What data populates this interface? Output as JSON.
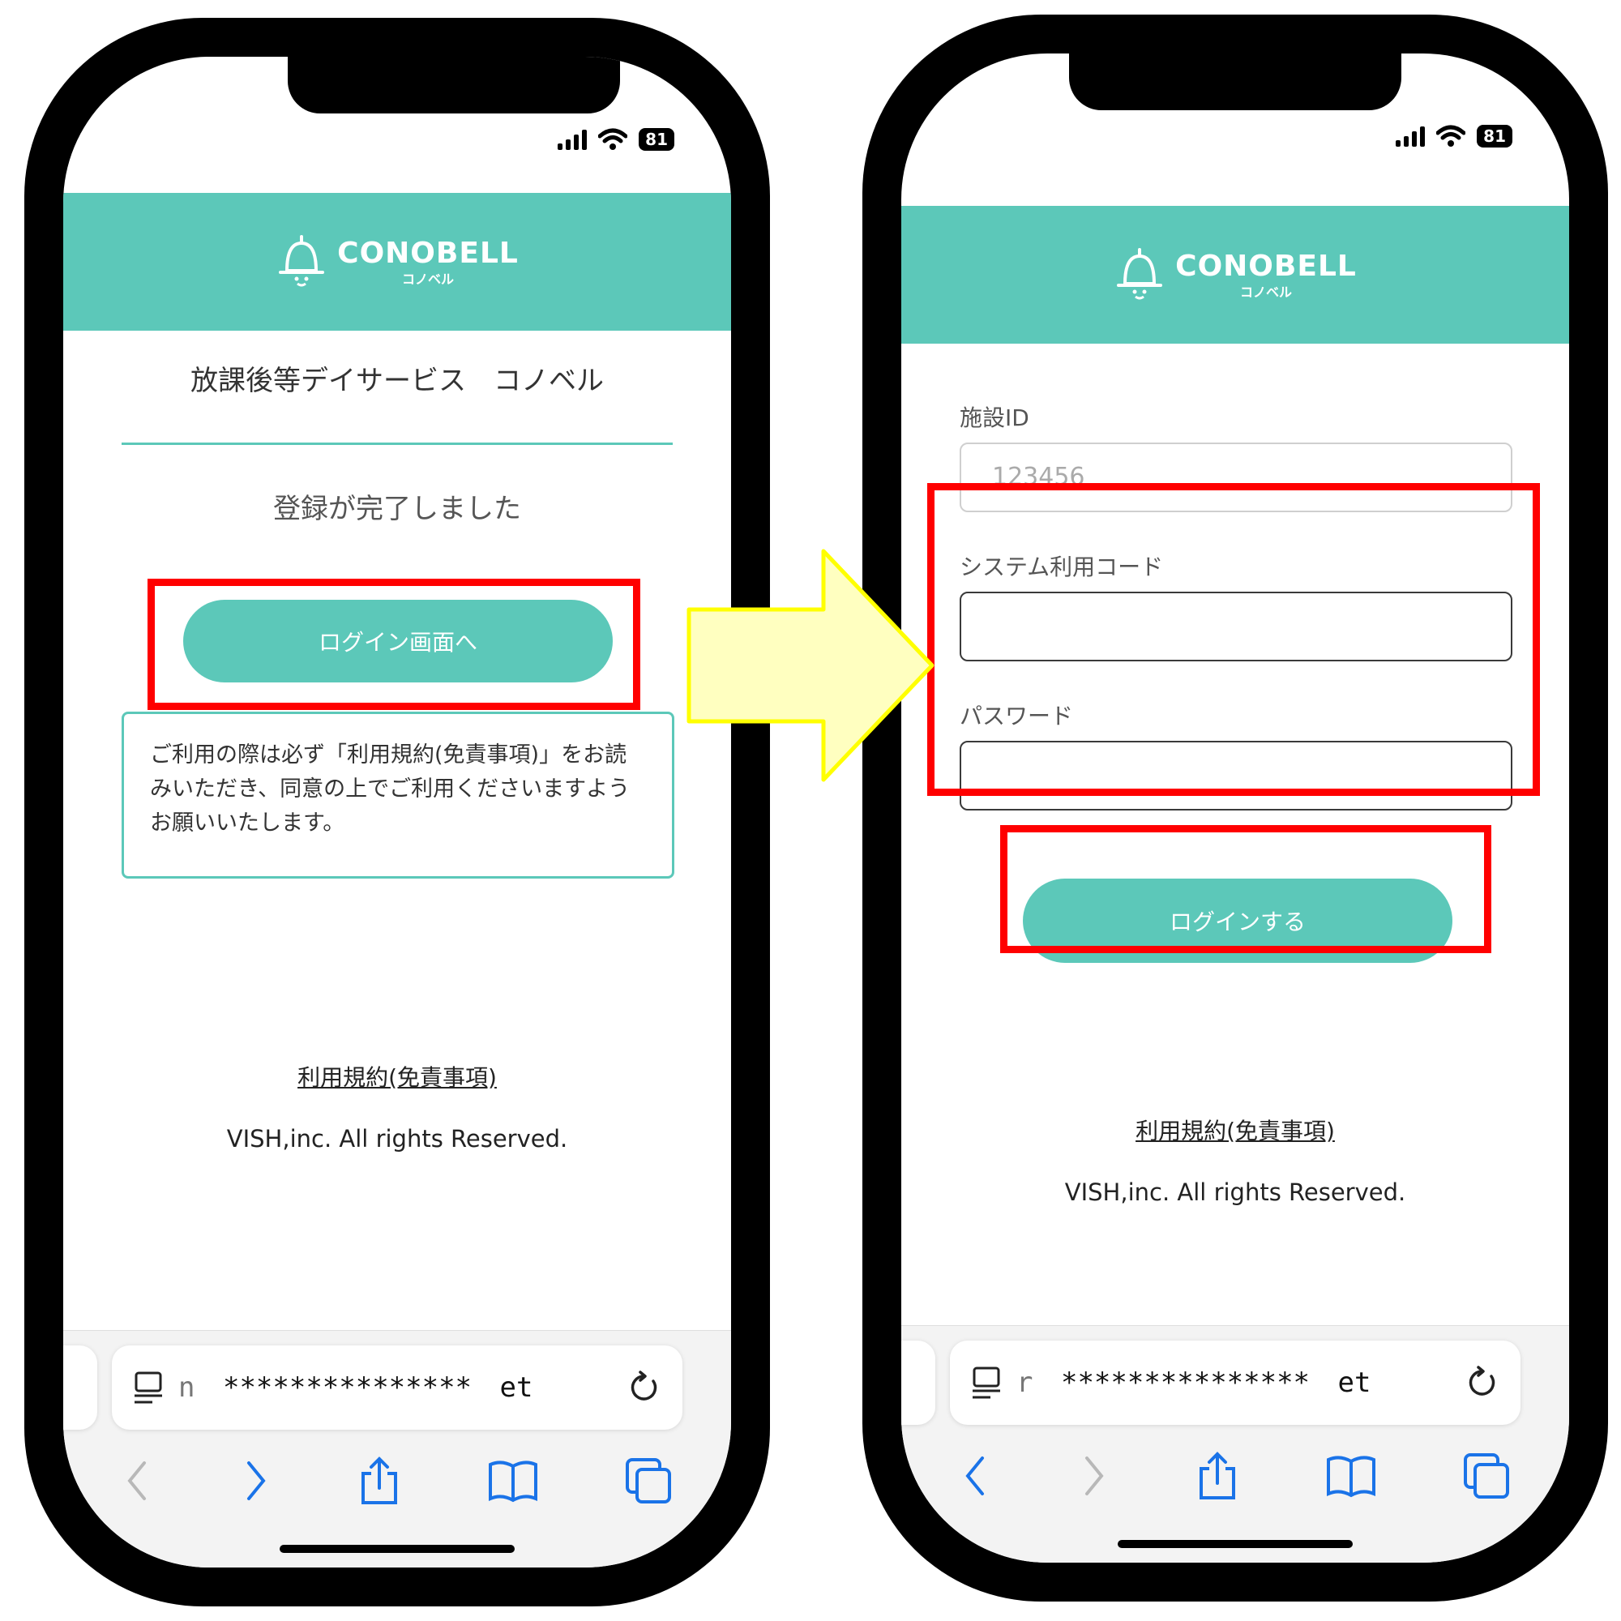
{
  "status_bar": {
    "battery": "81"
  },
  "brand": {
    "name": "CONOBELL",
    "kana": "コノベル"
  },
  "left_screen": {
    "facility_name": "放課後等デイサービス　コノベル",
    "message": "登録が完了しました",
    "login_button": "ログイン画面へ",
    "notice": "ご利用の際は必ず「利用規約(免責事項)」をお読みいただき、同意の上でご利用くださいますようお願いいたします。",
    "terms_link": "利用規約(免責事項)",
    "copyright": "VISH,inc. All rights Reserved.",
    "url_prefix": "n",
    "url_masked": "***************",
    "url_suffix": "et"
  },
  "right_screen": {
    "facility_id_label": "施設ID",
    "facility_id_placeholder": "123456",
    "system_code_label": "システム利用コード",
    "password_label": "パスワード",
    "login_button": "ログインする",
    "terms_link": "利用規約(免責事項)",
    "copyright": "VISH,inc. All rights Reserved.",
    "url_prefix": "r",
    "url_masked": "***************",
    "url_suffix": "et"
  },
  "colors": {
    "brand_teal": "#5cc8b9",
    "highlight_red": "#ff0000",
    "arrow_fill": "#ffffc0",
    "arrow_stroke": "#ffff00",
    "ios_blue": "#1a73e8"
  },
  "icons": [
    "bell-logo-icon",
    "signal-icon",
    "wifi-icon",
    "battery-icon",
    "tabs-menu-icon",
    "reload-icon",
    "back-icon",
    "forward-icon",
    "share-icon",
    "bookmarks-icon",
    "tabs-icon"
  ]
}
